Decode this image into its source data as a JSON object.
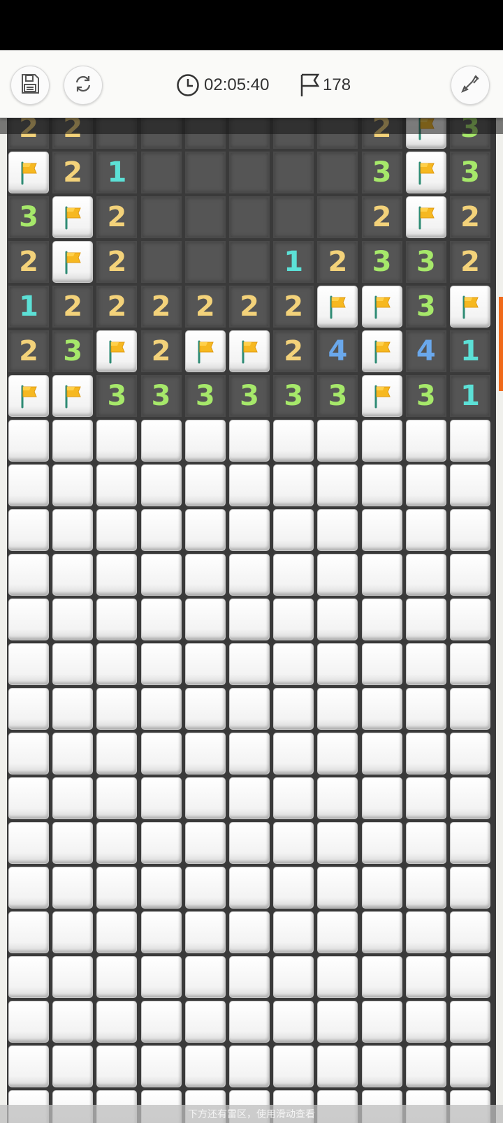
{
  "toolbar": {
    "save_icon": "save-icon",
    "restart_icon": "restart-icon",
    "timer_icon": "clock-icon",
    "timer": "02:05:40",
    "flag_icon": "flag-outline-icon",
    "flag_count": "178",
    "dig_icon": "shovel-icon"
  },
  "board": {
    "columns": 11,
    "rows": [
      [
        "2",
        "2",
        "R",
        "R",
        "R",
        "R",
        "R",
        "R",
        "2",
        "F",
        "3"
      ],
      [
        "F",
        "2",
        "1",
        "R",
        "R",
        "R",
        "R",
        "R",
        "3",
        "F",
        "3"
      ],
      [
        "3",
        "F",
        "2",
        "R",
        "R",
        "R",
        "R",
        "R",
        "2",
        "F",
        "2"
      ],
      [
        "2",
        "F",
        "2",
        "R",
        "R",
        "R",
        "1",
        "2",
        "3",
        "3",
        "2"
      ],
      [
        "1",
        "2",
        "2",
        "2",
        "2",
        "2",
        "2",
        "F",
        "F",
        "3",
        "F"
      ],
      [
        "2",
        "3",
        "F",
        "2",
        "F",
        "F",
        "2",
        "4",
        "F",
        "4",
        "1"
      ],
      [
        "F",
        "F",
        "3",
        "3",
        "3",
        "3",
        "3",
        "3",
        "F",
        "3",
        "1"
      ],
      [
        "U",
        "U",
        "U",
        "U",
        "U",
        "U",
        "U",
        "U",
        "U",
        "U",
        "U"
      ],
      [
        "U",
        "U",
        "U",
        "U",
        "U",
        "U",
        "U",
        "U",
        "U",
        "U",
        "U"
      ],
      [
        "U",
        "U",
        "U",
        "U",
        "U",
        "U",
        "U",
        "U",
        "U",
        "U",
        "U"
      ],
      [
        "U",
        "U",
        "U",
        "U",
        "U",
        "U",
        "U",
        "U",
        "U",
        "U",
        "U"
      ],
      [
        "U",
        "U",
        "U",
        "U",
        "U",
        "U",
        "U",
        "U",
        "U",
        "U",
        "U"
      ],
      [
        "U",
        "U",
        "U",
        "U",
        "U",
        "U",
        "U",
        "U",
        "U",
        "U",
        "U"
      ],
      [
        "U",
        "U",
        "U",
        "U",
        "U",
        "U",
        "U",
        "U",
        "U",
        "U",
        "U"
      ],
      [
        "U",
        "U",
        "U",
        "U",
        "U",
        "U",
        "U",
        "U",
        "U",
        "U",
        "U"
      ],
      [
        "U",
        "U",
        "U",
        "U",
        "U",
        "U",
        "U",
        "U",
        "U",
        "U",
        "U"
      ],
      [
        "U",
        "U",
        "U",
        "U",
        "U",
        "U",
        "U",
        "U",
        "U",
        "U",
        "U"
      ],
      [
        "U",
        "U",
        "U",
        "U",
        "U",
        "U",
        "U",
        "U",
        "U",
        "U",
        "U"
      ],
      [
        "U",
        "U",
        "U",
        "U",
        "U",
        "U",
        "U",
        "U",
        "U",
        "U",
        "U"
      ],
      [
        "U",
        "U",
        "U",
        "U",
        "U",
        "U",
        "U",
        "U",
        "U",
        "U",
        "U"
      ],
      [
        "U",
        "U",
        "U",
        "U",
        "U",
        "U",
        "U",
        "U",
        "U",
        "U",
        "U"
      ],
      [
        "U",
        "U",
        "U",
        "U",
        "U",
        "U",
        "U",
        "U",
        "U",
        "U",
        "U"
      ],
      [
        "U",
        "U",
        "U",
        "U",
        "U",
        "U",
        "U",
        "U",
        "U",
        "U",
        "U"
      ]
    ],
    "legend": {
      "R": "revealed-empty",
      "F": "flagged",
      "U": "unrevealed"
    }
  },
  "colors": {
    "n1": "#5ce0d6",
    "n2": "#f3d27a",
    "n3": "#a6e86a",
    "n4": "#6aa8ec",
    "scroll_indicator": "#f06a1a"
  },
  "footer": {
    "hint": "下方还有雷区，使用滑动查看"
  }
}
